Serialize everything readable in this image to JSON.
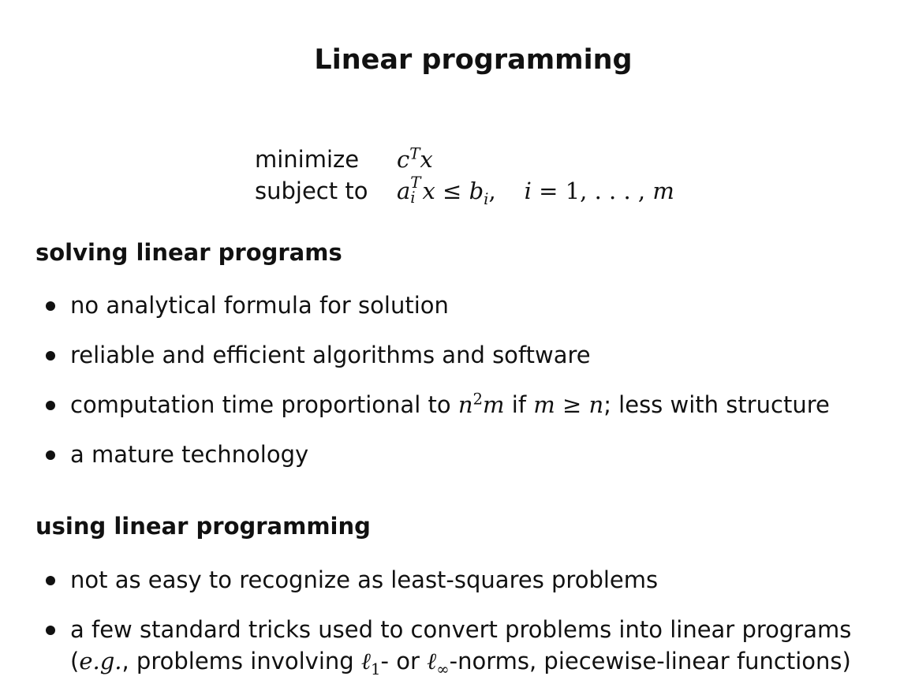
{
  "title": "Linear programming",
  "problem": {
    "row1_keyword": "minimize",
    "row2_keyword": "subject to",
    "objective": {
      "var_c": "c",
      "sup_T": "T",
      "var_x": "x"
    },
    "constraint": {
      "var_a": "a",
      "sup_T": "T",
      "sub_i": "i",
      "var_x": "x",
      "leq": "≤",
      "var_b": "b",
      "sub_i2": "i",
      "comma": ",",
      "index": "i",
      "equals": "=",
      "range": "1, . . . , ",
      "var_m": "m"
    }
  },
  "section1": {
    "heading": "solving linear programs",
    "items": {
      "item1": "no analytical formula for solution",
      "item2": "reliable and efficient algorithms and software",
      "item3": {
        "text_before": "computation time proportional to ",
        "math_n": "n",
        "math_sup": "2",
        "math_m": "m",
        "text_if": " if ",
        "cond_m": "m",
        "cond_geq": "≥",
        "cond_n": "n",
        "text_after": "; less with structure"
      },
      "item4": "a mature technology"
    }
  },
  "section2": {
    "heading": "using linear programming",
    "items": {
      "item1": "not as easy to recognize as least-squares problems",
      "item2": {
        "line1": "a few standard tricks used to convert problems into linear programs",
        "open_paren": "(",
        "eg": "e.g.",
        "text1": ", problems involving ",
        "ell": "ℓ",
        "sub_1": "1",
        "text2": "- or ",
        "ell2": "ℓ",
        "sub_inf": "∞",
        "text3": "-norms, piecewise-linear functions)"
      }
    }
  }
}
